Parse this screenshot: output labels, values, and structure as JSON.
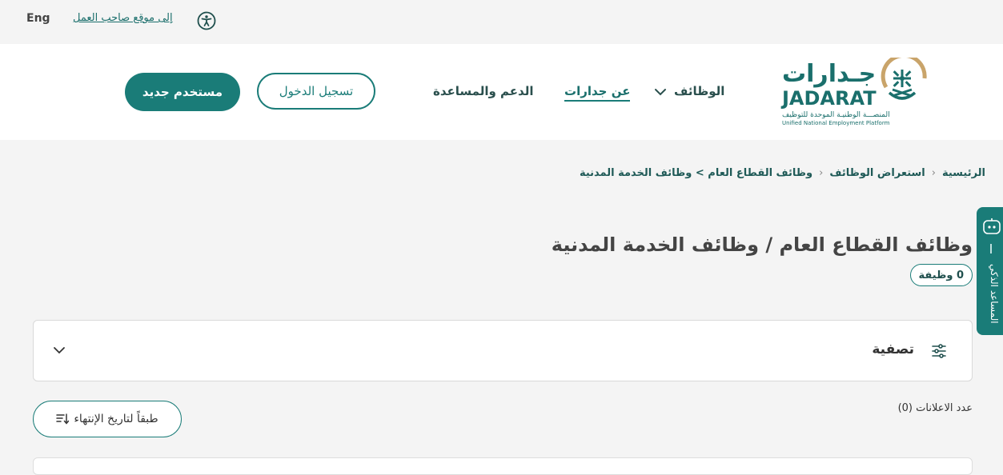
{
  "topbar": {
    "lang_label": "Eng",
    "employer_link": "إلى موقع صاحب العمل"
  },
  "header": {
    "new_user_button": "مستخدم جديد",
    "login_button": "تسجيل الدخول",
    "nav": {
      "support": "الدعم والمساعدة",
      "about": "عن جدارات",
      "jobs": "الوظائف"
    },
    "logo": {
      "arabic": "جـدارات",
      "latin": "JADARAT",
      "tagline_ar": "المنصـــة الوطنيـة الموحدة للتوظيف",
      "tagline_en": "Unified National Employment Platform"
    }
  },
  "breadcrumb": {
    "home": "الرئيسية",
    "browse": "استعراض الوظائف",
    "current": "وظائف القطاع العام > وظائف الخدمة المدنية"
  },
  "page": {
    "title": "وظائف القطاع العام / وظائف الخدمة المدنية",
    "jobs_count": "0 وظيفة"
  },
  "filter": {
    "label": "تصفية"
  },
  "results": {
    "ads_count": "عدد الاعلانات (0)",
    "sort_label": "طبقاً لتاريخ الإنتهاء"
  },
  "assistant": {
    "label": "المساعد الذكي"
  },
  "colors": {
    "primary": "#1a7c78",
    "gold": "#c9a46a",
    "background": "#f4f4f4"
  }
}
